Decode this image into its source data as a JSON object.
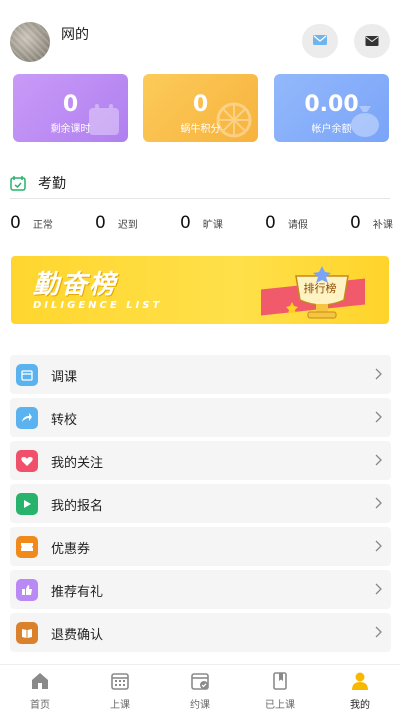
{
  "header": {
    "username": "网的",
    "message_icon": "message-icon",
    "mail_icon": "mail-icon"
  },
  "cards": [
    {
      "value": "0",
      "label": "剩余课时",
      "color": "#b98af4",
      "icon": "calendar-icon"
    },
    {
      "value": "0",
      "label": "蜗牛积分",
      "color": "#f9be48",
      "icon": "orange-slice-icon"
    },
    {
      "value": "0.00",
      "label": "帐户余额",
      "color": "#86adfa",
      "icon": "money-bag-icon"
    }
  ],
  "attendance": {
    "title": "考勤",
    "icon": "calendar-check-icon",
    "stats": [
      {
        "value": "0",
        "label": "正常"
      },
      {
        "value": "0",
        "label": "迟到"
      },
      {
        "value": "0",
        "label": "旷课"
      },
      {
        "value": "0",
        "label": "请假"
      },
      {
        "value": "0",
        "label": "补课"
      }
    ]
  },
  "banner": {
    "title": "勤奋榜",
    "subtitle": "DILIGENCE LIST",
    "badge": "排行榜"
  },
  "menu": [
    {
      "label": "调课",
      "icon": "reschedule-icon",
      "color": "#5ab2ee"
    },
    {
      "label": "转校",
      "icon": "share-arrow-icon",
      "color": "#5ab2ee"
    },
    {
      "label": "我的关注",
      "icon": "heart-icon",
      "color": "#f0506a"
    },
    {
      "label": "我的报名",
      "icon": "play-file-icon",
      "color": "#27b36b"
    },
    {
      "label": "优惠券",
      "icon": "coupon-icon",
      "color": "#f08a1c"
    },
    {
      "label": "推荐有礼",
      "icon": "thumbs-up-icon",
      "color": "#b98af4"
    },
    {
      "label": "退费确认",
      "icon": "book-icon",
      "color": "#d9822b"
    }
  ],
  "tabbar": [
    {
      "label": "首页",
      "icon": "home-icon"
    },
    {
      "label": "上课",
      "icon": "calendar-grid-icon"
    },
    {
      "label": "约课",
      "icon": "calendar-check-icon"
    },
    {
      "label": "已上课",
      "icon": "book-icon"
    },
    {
      "label": "我的",
      "icon": "person-icon",
      "active": true,
      "color": "#f8b800"
    }
  ]
}
